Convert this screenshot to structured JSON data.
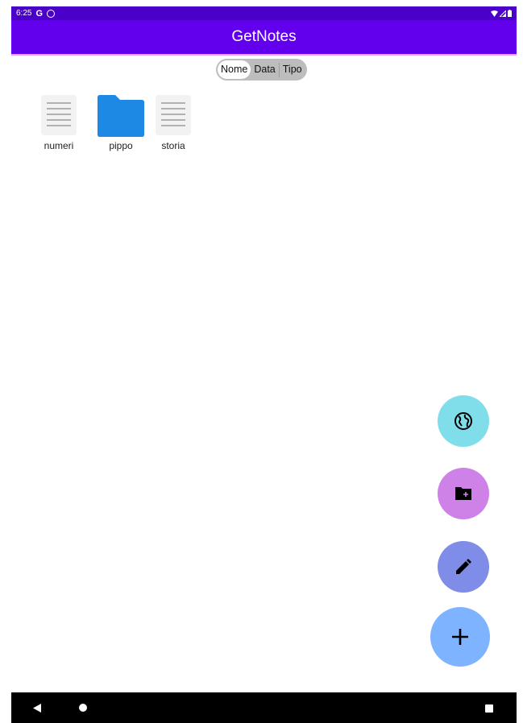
{
  "status_bar": {
    "time": "6:25",
    "g_label": "G"
  },
  "app_bar": {
    "title": "GetNotes",
    "color": "#6200ee"
  },
  "sort": {
    "options": [
      "Nome",
      "Data",
      "Tipo"
    ],
    "selected": "Nome"
  },
  "files": [
    {
      "name": "numeri",
      "kind": "note",
      "icon": "note-icon"
    },
    {
      "name": "pippo",
      "kind": "folder",
      "icon": "folder-icon"
    },
    {
      "name": "storia",
      "kind": "note",
      "icon": "note-icon"
    }
  ],
  "fabs": [
    {
      "name": "globe",
      "icon": "globe-icon",
      "color": "#80deea"
    },
    {
      "name": "new-folder",
      "icon": "create-folder-icon",
      "color": "#ce82e8"
    },
    {
      "name": "edit",
      "icon": "pencil-icon",
      "color": "#7f8ce8"
    },
    {
      "name": "add",
      "icon": "plus-icon",
      "color": "#7eb3ff"
    }
  ],
  "nav": {
    "icons": [
      "back-icon",
      "home-icon",
      "recents-icon"
    ]
  }
}
